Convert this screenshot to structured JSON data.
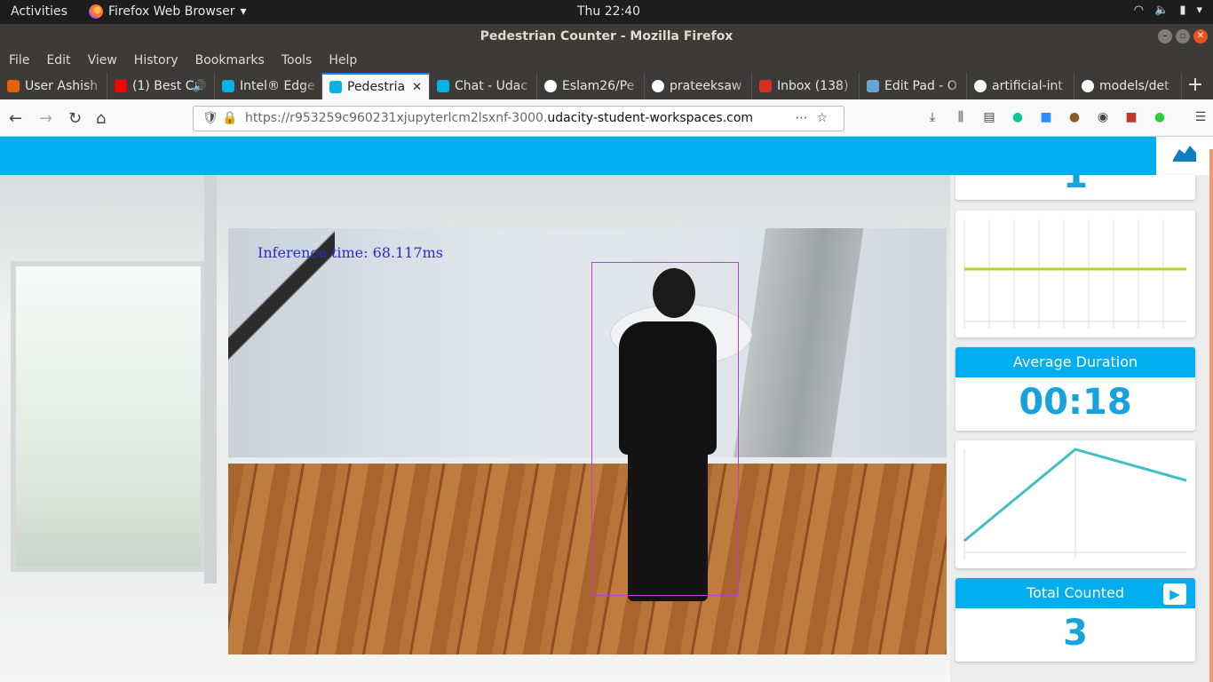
{
  "system": {
    "activities": "Activities",
    "app_name": "Firefox Web Browser",
    "clock": "Thu 22:40"
  },
  "window": {
    "title": "Pedestrian Counter - Mozilla Firefox"
  },
  "menu": [
    "File",
    "Edit",
    "View",
    "History",
    "Bookmarks",
    "Tools",
    "Help"
  ],
  "tabs": [
    {
      "label": "User Ashish",
      "icon_color": "#e66000"
    },
    {
      "label": "(1) Best C",
      "icon_color": "#ff0000"
    },
    {
      "label": "Intel® Edge",
      "icon_color": "#02b3e4"
    },
    {
      "label": "Pedestria",
      "icon_color": "#02b3e4",
      "active": true
    },
    {
      "label": "Chat - Udac",
      "icon_color": "#02b3e4"
    },
    {
      "label": "Eslam26/Pe",
      "icon_color": "#ffffff"
    },
    {
      "label": "prateeksaw",
      "icon_color": "#ffffff"
    },
    {
      "label": "Inbox (138)",
      "icon_color": "#d93025"
    },
    {
      "label": "Edit Pad - O",
      "icon_color": "#6aa3d8"
    },
    {
      "label": "artificial-int",
      "icon_color": "#ffffff"
    },
    {
      "label": "models/det",
      "icon_color": "#ffffff"
    }
  ],
  "url": {
    "prefix": "https://r953259c960231xjupyterlcm2lsxnf-3000.",
    "host": "udacity-student-workspaces.com"
  },
  "video": {
    "inference_text": "Inference time: 68.117ms"
  },
  "panels": {
    "top_partial_value": "1",
    "average_duration": {
      "title": "Average Duration",
      "value": "00:18"
    },
    "total_counted": {
      "title": "Total Counted",
      "value": "3"
    }
  },
  "colors": {
    "accent": "#00aeef",
    "value_blue": "#16a2dd",
    "line_yellow": "#b5d22b",
    "line_teal": "#43bec4"
  }
}
